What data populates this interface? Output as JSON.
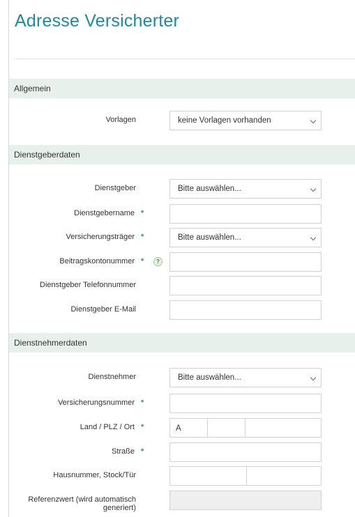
{
  "page": {
    "title": "Adresse Versicherter"
  },
  "sections": {
    "allgemein": "Allgemein",
    "dienstgeber": "Dienstgeberdaten",
    "dienstnehmer": "Dienstnehmerdaten"
  },
  "fields": {
    "vorlagen": {
      "label": "Vorlagen",
      "value": "keine Vorlagen vorhanden"
    },
    "dienstgeber": {
      "label": "Dienstgeber",
      "value": "Bitte auswählen..."
    },
    "dienstgebername": {
      "label": "Dienstgebername",
      "required": "*"
    },
    "versicherungstraeger": {
      "label": "Versicherungsträger",
      "required": "*",
      "value": "Bitte auswählen..."
    },
    "beitragskontonummer": {
      "label": "Beitragskontonummer",
      "required": "*",
      "help": "?"
    },
    "dg_telefon": {
      "label": "Dienstgeber Telefonnummer"
    },
    "dg_email": {
      "label": "Dienstgeber E-Mail"
    },
    "dienstnehmer": {
      "label": "Dienstnehmer",
      "value": "Bitte auswählen..."
    },
    "versicherungsnummer": {
      "label": "Versicherungsnummer",
      "required": "*"
    },
    "land_plz_ort": {
      "label": "Land / PLZ / Ort",
      "required": "*",
      "land_value": "A"
    },
    "strasse": {
      "label": "Straße",
      "required": "*"
    },
    "hausnummer": {
      "label": "Hausnummer, Stock/Tür"
    },
    "referenzwert": {
      "label_line1": "Referenzwert (wird automatisch",
      "label_line2": "generiert)"
    }
  },
  "colors": {
    "accent": "#1e8aa0",
    "section_bg": "#e8f0ec",
    "required": "#2e9a56"
  }
}
